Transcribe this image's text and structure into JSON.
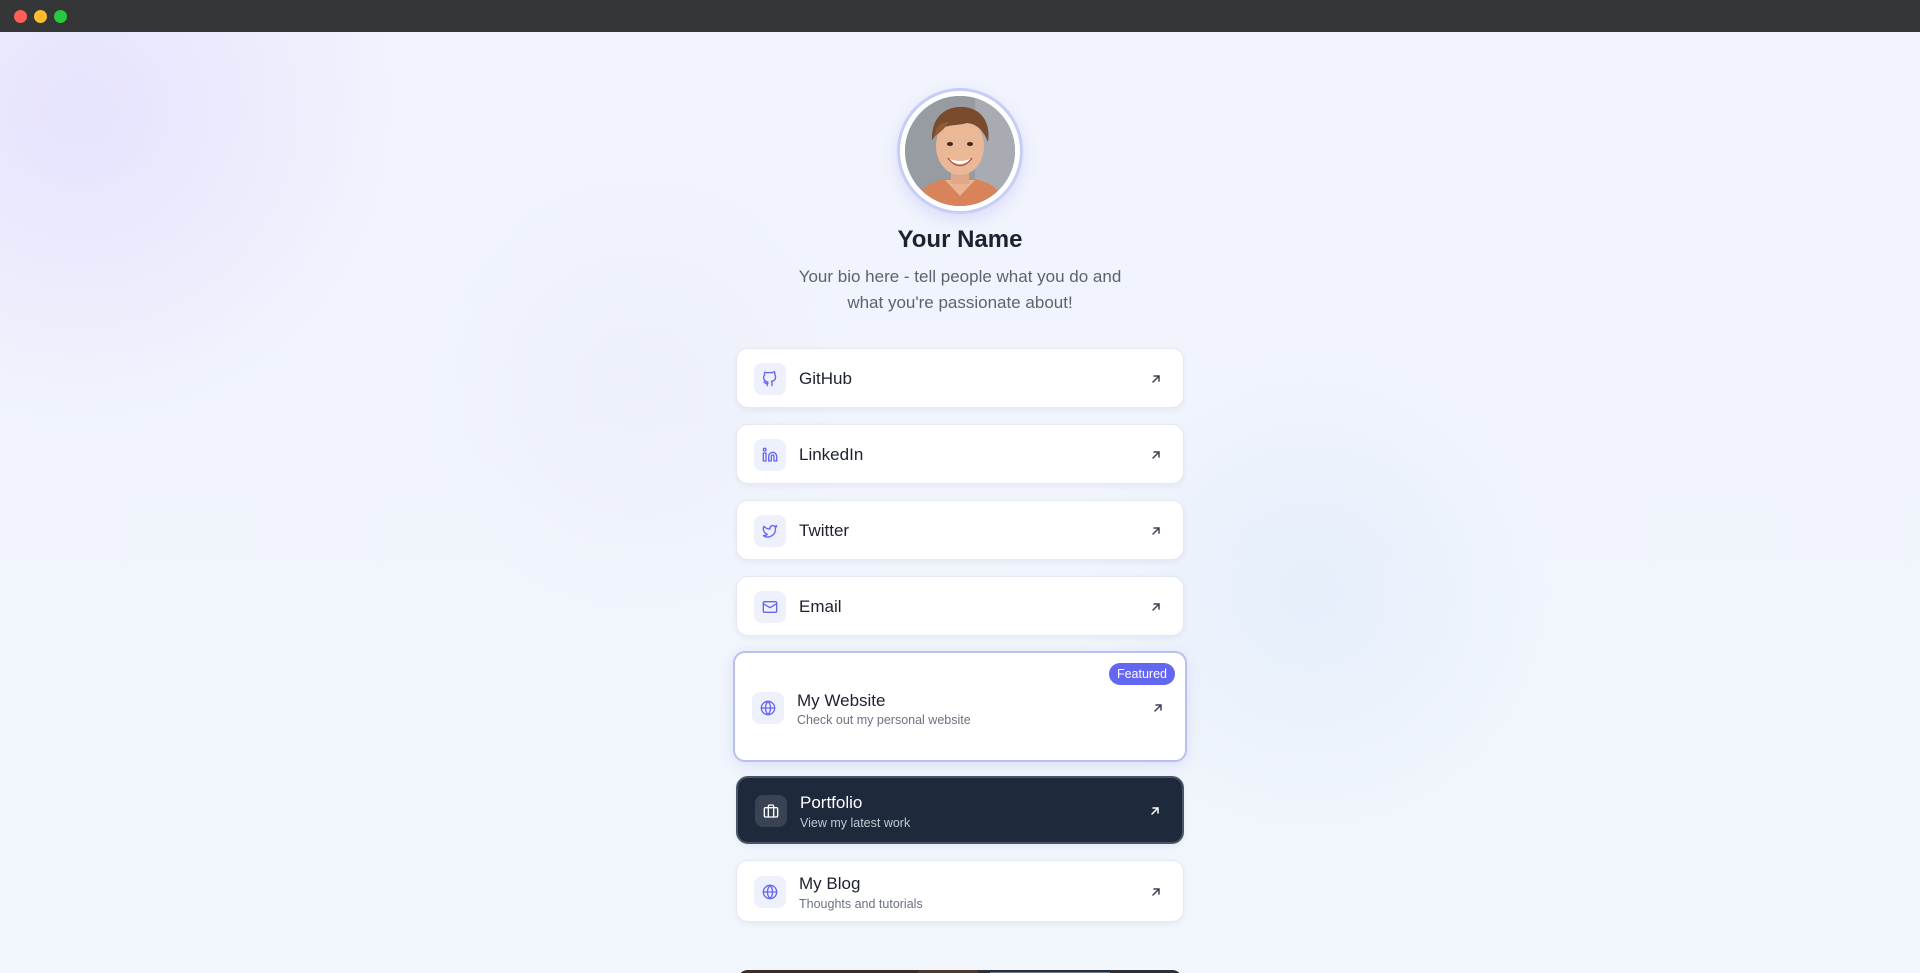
{
  "window": {
    "controls": [
      "close",
      "minimize",
      "maximize"
    ]
  },
  "profile": {
    "name": "Your Name",
    "bio": "Your bio here - tell people what you do and what you're passionate about!"
  },
  "links": [
    {
      "title": "GitHub",
      "icon": "github-icon"
    },
    {
      "title": "LinkedIn",
      "icon": "linkedin-icon"
    },
    {
      "title": "Twitter",
      "icon": "twitter-icon"
    },
    {
      "title": "Email",
      "icon": "mail-icon"
    },
    {
      "title": "My Website",
      "subtitle": "Check out my personal website",
      "icon": "globe-icon",
      "badge": "Featured"
    },
    {
      "title": "Portfolio",
      "subtitle": "View my latest work",
      "icon": "briefcase-icon"
    },
    {
      "title": "My Blog",
      "subtitle": "Thoughts and tutorials",
      "icon": "globe-icon"
    }
  ],
  "colors": {
    "accent": "#6366f1",
    "dark_card": "#1e293b",
    "icon_tint": "#6366f1"
  }
}
